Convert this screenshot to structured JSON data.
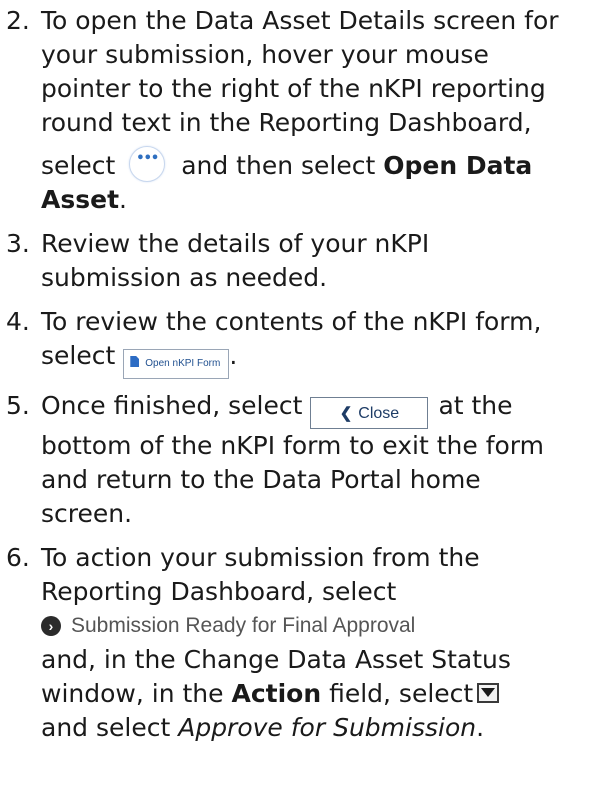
{
  "steps": [
    {
      "number": "2.",
      "lines": [
        "To open the Data Asset Details screen for",
        "your submission, hover your mouse",
        "pointer to the right of the nKPI reporting",
        "round text in the Reporting Dashboard,"
      ],
      "select_text": "select",
      "ellipsis_glyph": "•••",
      "after_ellipsis": "and then select",
      "bold_action": "Open Data",
      "bold_action_cont": "Asset",
      "end_punct": "."
    },
    {
      "number": "3.",
      "lines": [
        "Review the details of your nKPI",
        "submission as needed."
      ]
    },
    {
      "number": "4.",
      "lines": [
        "To review the contents of the nKPI form,"
      ],
      "select_text": "select",
      "button_label": "Open nKPI Form",
      "button_icon": "document-icon",
      "end_punct": "."
    },
    {
      "number": "5.",
      "first_text": "Once finished, select",
      "button_chevron": "❮",
      "button_label": "Close",
      "after_button": "at the",
      "lines": [
        "bottom of the nKPI form to exit the form",
        "and return to the Data Portal home",
        "screen."
      ]
    },
    {
      "number": "6.",
      "lines": [
        "To action your submission from the",
        "Reporting Dashboard, select"
      ],
      "status_icon": "chevron-circle-right-icon",
      "status_glyph": "›",
      "status_label": "Submission Ready for Final Approval",
      "lines_after": [
        "and, in the Change Data Asset Status"
      ],
      "window_text": "window, in the",
      "bold_field": "Action",
      "field_text": "field, select",
      "dropdown_icon": "dropdown-arrow-icon",
      "final_select": "and select",
      "italic_option": "Approve for Submission",
      "end_punct": "."
    }
  ]
}
